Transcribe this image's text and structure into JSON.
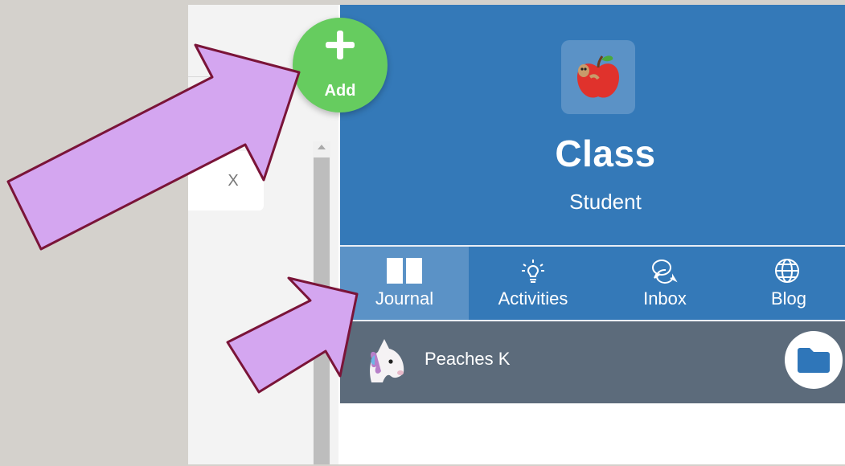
{
  "add_button": {
    "label": "Add",
    "icon": "plus-icon"
  },
  "dialog": {
    "close_label": "X"
  },
  "class_header": {
    "title": "Class",
    "subtitle": "Student",
    "icon": "apple-icon"
  },
  "tabs": [
    {
      "label": "Journal",
      "icon": "book-icon",
      "active": true
    },
    {
      "label": "Activities",
      "icon": "lightbulb-icon",
      "active": false
    },
    {
      "label": "Inbox",
      "icon": "chat-bubbles-icon",
      "active": false
    },
    {
      "label": "Blog",
      "icon": "globe-icon",
      "active": false
    }
  ],
  "student": {
    "name": "Peaches K",
    "avatar_icon": "unicorn-icon",
    "folder_icon": "folder-icon"
  },
  "colors": {
    "header_blue": "#3479b8",
    "active_tab": "#5b92c6",
    "student_bar": "#5c6b7b",
    "add_green": "#66cc5f",
    "arrow_fill": "#d4a6f0",
    "arrow_stroke": "#7a1438"
  }
}
